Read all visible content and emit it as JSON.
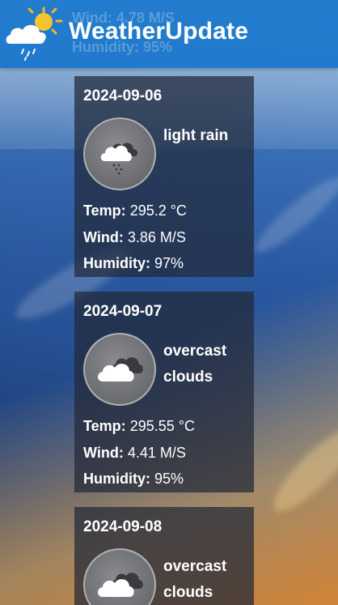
{
  "header": {
    "title": "WeatherUpdate",
    "logo_icon": "sun-cloud-rain-icon"
  },
  "ghost_text": {
    "wind": "Wind: 4.78 M/S",
    "humidity": "Humidity: 95%"
  },
  "labels": {
    "temp": "Temp:",
    "wind": "Wind:",
    "humidity": "Humidity:"
  },
  "forecasts": [
    {
      "date": "2024-09-06",
      "description": "light rain",
      "icon": "light-rain-icon",
      "temp": "295.2 °C",
      "wind": "3.86 M/S",
      "humidity": "97%"
    },
    {
      "date": "2024-09-07",
      "description": "overcast clouds",
      "icon": "overcast-clouds-icon",
      "temp": "295.55 °C",
      "wind": "4.41 M/S",
      "humidity": "95%"
    },
    {
      "date": "2024-09-08",
      "description": "overcast clouds",
      "icon": "overcast-clouds-icon"
    }
  ]
}
